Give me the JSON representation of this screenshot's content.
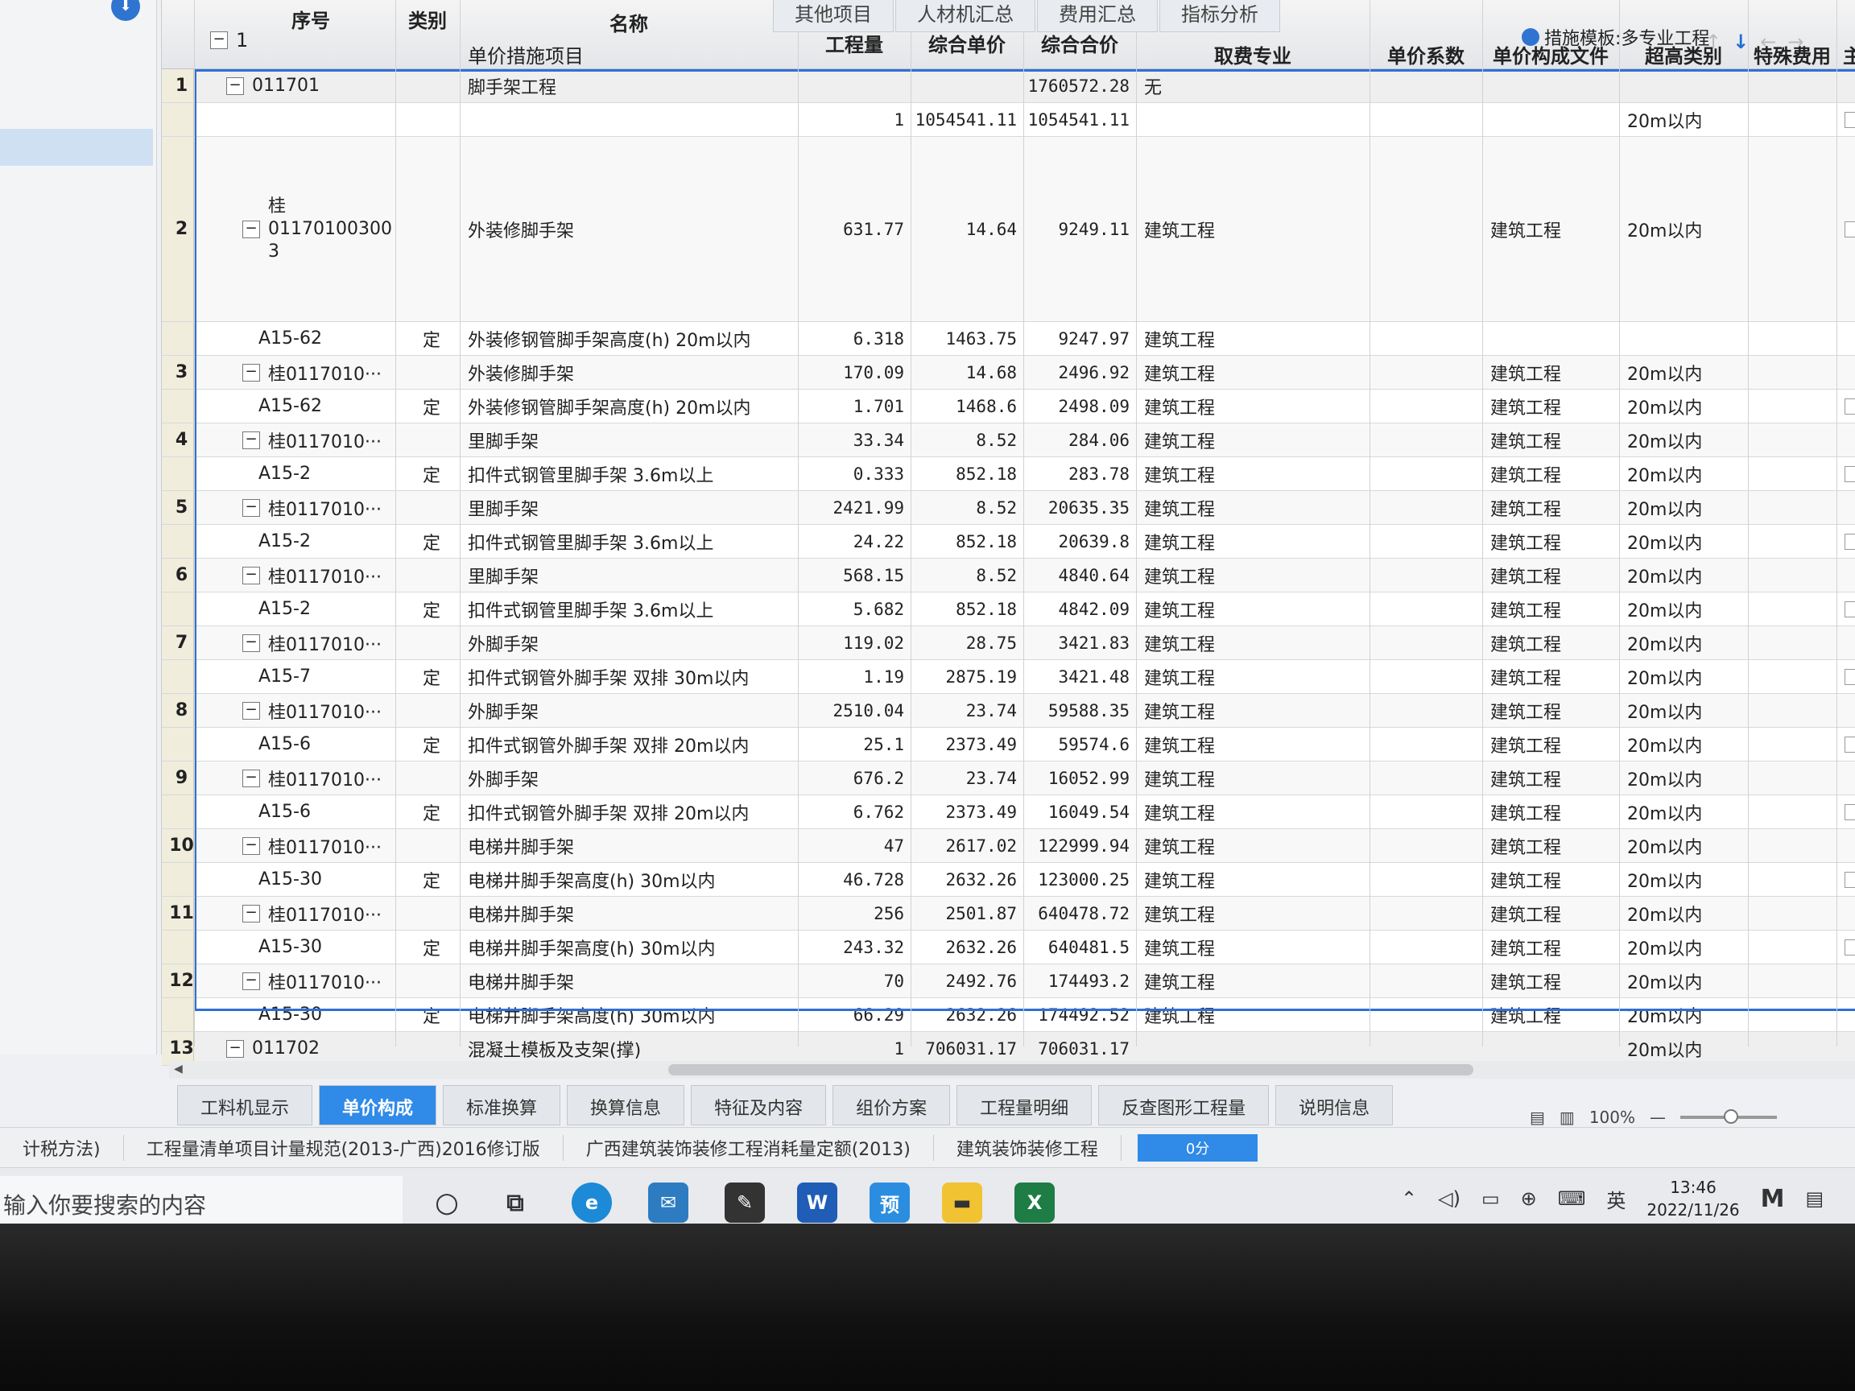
{
  "app": {
    "top_tabs": [
      "其他项目",
      "人材机汇总",
      "费用汇总",
      "指标分析"
    ],
    "template_label": "措施模板:多专业工程"
  },
  "headers": {
    "seq": "序号",
    "category": "类别",
    "name": "名称",
    "quantity": "工程量",
    "unit_price": "综合单价",
    "total_price": "综合合价",
    "fee_specialty": "取费专业",
    "price_coef": "单价系数",
    "price_file": "单价构成文件",
    "height_class": "超高类别",
    "special_fee": "特殊费用",
    "main_flag": "主要"
  },
  "root_row": {
    "code": "1",
    "name": "单价措施项目"
  },
  "rows": [
    {
      "no": "1",
      "kind": "section",
      "code": "011701",
      "cat": "",
      "name": "脚手架工程",
      "qty": "",
      "price": "",
      "total": "1760572.28",
      "spec": "无",
      "file": "",
      "height": "",
      "check": false
    },
    {
      "no": "",
      "kind": "sub",
      "code": "",
      "cat": "",
      "name": "",
      "qty": "1",
      "price": "1054541.11",
      "total": "1054541.11",
      "spec": "",
      "file": "",
      "height": "20m以内",
      "check": true
    },
    {
      "no": "2",
      "kind": "main",
      "code": "桂 01170100300 3",
      "cat": "",
      "name": "外装修脚手架",
      "qty": "631.77",
      "price": "14.64",
      "total": "9249.11",
      "spec": "建筑工程",
      "file": "建筑工程",
      "height": "20m以内",
      "check": true
    },
    {
      "no": "",
      "kind": "sub",
      "code": "A15-62",
      "cat": "定",
      "name": "外装修钢管脚手架高度(h) 20m以内",
      "qty": "6.318",
      "price": "1463.75",
      "total": "9247.97",
      "spec": "建筑工程",
      "file": "",
      "height": "",
      "check": false
    },
    {
      "no": "3",
      "kind": "main",
      "code": "桂0117010···",
      "cat": "",
      "name": "外装修脚手架",
      "qty": "170.09",
      "price": "14.68",
      "total": "2496.92",
      "spec": "建筑工程",
      "file": "建筑工程",
      "height": "20m以内",
      "check": false
    },
    {
      "no": "",
      "kind": "sub",
      "code": "A15-62",
      "cat": "定",
      "name": "外装修钢管脚手架高度(h) 20m以内",
      "qty": "1.701",
      "price": "1468.6",
      "total": "2498.09",
      "spec": "建筑工程",
      "file": "建筑工程",
      "height": "20m以内",
      "check": true
    },
    {
      "no": "4",
      "kind": "main",
      "code": "桂0117010···",
      "cat": "",
      "name": "里脚手架",
      "qty": "33.34",
      "price": "8.52",
      "total": "284.06",
      "spec": "建筑工程",
      "file": "建筑工程",
      "height": "20m以内",
      "check": false
    },
    {
      "no": "",
      "kind": "sub",
      "code": "A15-2",
      "cat": "定",
      "name": "扣件式钢管里脚手架 3.6m以上",
      "qty": "0.333",
      "price": "852.18",
      "total": "283.78",
      "spec": "建筑工程",
      "file": "建筑工程",
      "height": "20m以内",
      "check": true
    },
    {
      "no": "5",
      "kind": "main",
      "code": "桂0117010···",
      "cat": "",
      "name": "里脚手架",
      "qty": "2421.99",
      "price": "8.52",
      "total": "20635.35",
      "spec": "建筑工程",
      "file": "建筑工程",
      "height": "20m以内",
      "check": false
    },
    {
      "no": "",
      "kind": "sub",
      "code": "A15-2",
      "cat": "定",
      "name": "扣件式钢管里脚手架 3.6m以上",
      "qty": "24.22",
      "price": "852.18",
      "total": "20639.8",
      "spec": "建筑工程",
      "file": "建筑工程",
      "height": "20m以内",
      "check": true
    },
    {
      "no": "6",
      "kind": "main",
      "code": "桂0117010···",
      "cat": "",
      "name": "里脚手架",
      "qty": "568.15",
      "price": "8.52",
      "total": "4840.64",
      "spec": "建筑工程",
      "file": "建筑工程",
      "height": "20m以内",
      "check": false
    },
    {
      "no": "",
      "kind": "sub",
      "code": "A15-2",
      "cat": "定",
      "name": "扣件式钢管里脚手架 3.6m以上",
      "qty": "5.682",
      "price": "852.18",
      "total": "4842.09",
      "spec": "建筑工程",
      "file": "建筑工程",
      "height": "20m以内",
      "check": true
    },
    {
      "no": "7",
      "kind": "main",
      "code": "桂0117010···",
      "cat": "",
      "name": "外脚手架",
      "qty": "119.02",
      "price": "28.75",
      "total": "3421.83",
      "spec": "建筑工程",
      "file": "建筑工程",
      "height": "20m以内",
      "check": false
    },
    {
      "no": "",
      "kind": "sub",
      "code": "A15-7",
      "cat": "定",
      "name": "扣件式钢管外脚手架 双排 30m以内",
      "qty": "1.19",
      "price": "2875.19",
      "total": "3421.48",
      "spec": "建筑工程",
      "file": "建筑工程",
      "height": "20m以内",
      "check": true
    },
    {
      "no": "8",
      "kind": "main",
      "code": "桂0117010···",
      "cat": "",
      "name": "外脚手架",
      "qty": "2510.04",
      "price": "23.74",
      "total": "59588.35",
      "spec": "建筑工程",
      "file": "建筑工程",
      "height": "20m以内",
      "check": false
    },
    {
      "no": "",
      "kind": "sub",
      "code": "A15-6",
      "cat": "定",
      "name": "扣件式钢管外脚手架 双排 20m以内",
      "qty": "25.1",
      "price": "2373.49",
      "total": "59574.6",
      "spec": "建筑工程",
      "file": "建筑工程",
      "height": "20m以内",
      "check": true
    },
    {
      "no": "9",
      "kind": "main",
      "code": "桂0117010···",
      "cat": "",
      "name": "外脚手架",
      "qty": "676.2",
      "price": "23.74",
      "total": "16052.99",
      "spec": "建筑工程",
      "file": "建筑工程",
      "height": "20m以内",
      "check": false
    },
    {
      "no": "",
      "kind": "sub",
      "code": "A15-6",
      "cat": "定",
      "name": "扣件式钢管外脚手架 双排 20m以内",
      "qty": "6.762",
      "price": "2373.49",
      "total": "16049.54",
      "spec": "建筑工程",
      "file": "建筑工程",
      "height": "20m以内",
      "check": true
    },
    {
      "no": "10",
      "kind": "main",
      "code": "桂0117010···",
      "cat": "",
      "name": "电梯井脚手架",
      "qty": "47",
      "price": "2617.02",
      "total": "122999.94",
      "spec": "建筑工程",
      "file": "建筑工程",
      "height": "20m以内",
      "check": false
    },
    {
      "no": "",
      "kind": "sub",
      "code": "A15-30",
      "cat": "定",
      "name": "电梯井脚手架高度(h) 30m以内",
      "qty": "46.728",
      "price": "2632.26",
      "total": "123000.25",
      "spec": "建筑工程",
      "file": "建筑工程",
      "height": "20m以内",
      "check": true
    },
    {
      "no": "11",
      "kind": "main",
      "code": "桂0117010···",
      "cat": "",
      "name": "电梯井脚手架",
      "qty": "256",
      "price": "2501.87",
      "total": "640478.72",
      "spec": "建筑工程",
      "file": "建筑工程",
      "height": "20m以内",
      "check": false
    },
    {
      "no": "",
      "kind": "sub",
      "code": "A15-30",
      "cat": "定",
      "name": "电梯井脚手架高度(h) 30m以内",
      "qty": "243.32",
      "price": "2632.26",
      "total": "640481.5",
      "spec": "建筑工程",
      "file": "建筑工程",
      "height": "20m以内",
      "check": true
    },
    {
      "no": "12",
      "kind": "main",
      "code": "桂0117010···",
      "cat": "",
      "name": "电梯井脚手架",
      "qty": "70",
      "price": "2492.76",
      "total": "174493.2",
      "spec": "建筑工程",
      "file": "建筑工程",
      "height": "20m以内",
      "check": false
    },
    {
      "no": "",
      "kind": "sub",
      "code": "A15-30",
      "cat": "定",
      "name": "电梯井脚手架高度(h) 30m以内",
      "qty": "66.29",
      "price": "2632.26",
      "total": "174492.52",
      "spec": "建筑工程",
      "file": "建筑工程",
      "height": "20m以内",
      "check": false
    },
    {
      "no": "13",
      "kind": "section",
      "code": "011702",
      "cat": "",
      "name": "混凝土模板及支架(撑)",
      "qty": "1",
      "price": "706031.17",
      "total": "706031.17",
      "spec": "",
      "file": "",
      "height": "20m以内",
      "check": false
    }
  ],
  "bottom_tabs": [
    "工料机显示",
    "单价构成",
    "标准换算",
    "换算信息",
    "特征及内容",
    "组价方案",
    "工程量明细",
    "反查图形工程量",
    "说明信息"
  ],
  "status": {
    "tax_method": "计税方法)",
    "spec1": "工程量清单项目计量规范(2013-广西)2016修订版",
    "spec2": "广西建筑装饰装修工程消耗量定额(2013)",
    "spec3": "建筑装饰装修工程",
    "badge": "0分",
    "zoom": "100%"
  },
  "taskbar": {
    "search_placeholder": "输入你要搜索的内容",
    "apps": [
      "edge",
      "mail",
      "word",
      "预",
      "files",
      "excel"
    ],
    "ime": "英",
    "time": "13:46",
    "date": "2022/11/26"
  }
}
